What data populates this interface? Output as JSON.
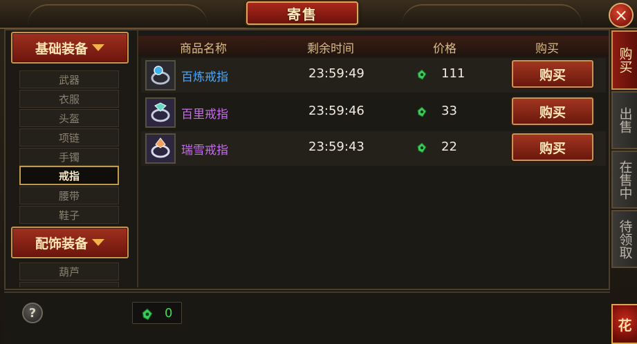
{
  "window": {
    "title": "寄售"
  },
  "categories": [
    {
      "label": "基础装备",
      "items": [
        "武器",
        "衣服",
        "头盔",
        "项链",
        "手镯",
        "戒指",
        "腰带",
        "鞋子"
      ],
      "selected": "戒指"
    },
    {
      "label": "配饰装备",
      "items": [
        "葫芦"
      ]
    }
  ],
  "table": {
    "headers": [
      "商品名称",
      "剩余时间",
      "价格",
      "购买"
    ],
    "rows": [
      {
        "name": "百炼戒指",
        "name_color": "#4aa8ff",
        "time": "23:59:49",
        "price": "111",
        "action": "购买",
        "icon": "ring-icon"
      },
      {
        "name": "百里戒指",
        "name_color": "#c86cf0",
        "time": "23:59:46",
        "price": "33",
        "action": "购买",
        "icon": "ring-icon"
      },
      {
        "name": "瑞雪戒指",
        "name_color": "#c86cf0",
        "time": "23:59:43",
        "price": "22",
        "action": "购买",
        "icon": "ring-icon"
      }
    ]
  },
  "side_tabs": [
    {
      "label": "购买",
      "active": true
    },
    {
      "label": "出售",
      "active": false
    },
    {
      "label": "在售中",
      "active": false
    },
    {
      "label": "待领取",
      "active": false
    }
  ],
  "footer": {
    "help": "?",
    "balance": "0",
    "currency_icon": "jade-gem-icon"
  },
  "corner_badge": "花",
  "colors": {
    "accent": "#8c1c12",
    "gold": "#c89252",
    "currency": "#48d65c"
  }
}
